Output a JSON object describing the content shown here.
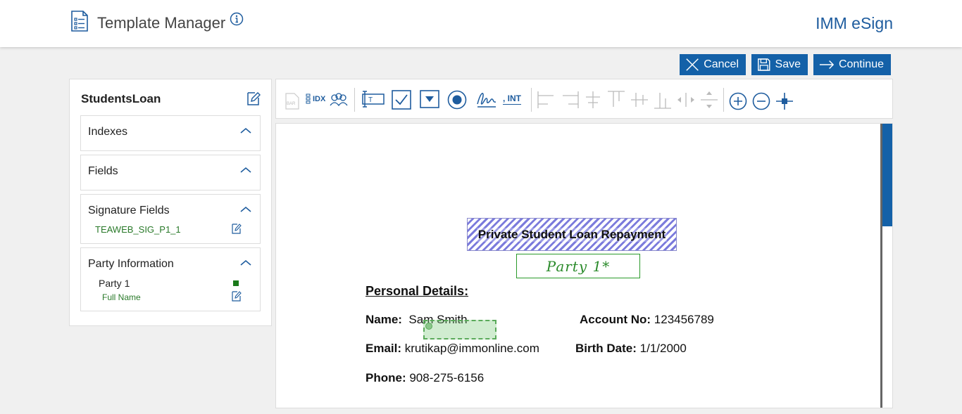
{
  "header": {
    "title": "Template Manager",
    "brand": "IMM eSign"
  },
  "actions": {
    "cancel": "Cancel",
    "save": "Save",
    "continue": "Continue"
  },
  "left_panel": {
    "template_name": "StudentsLoan",
    "sections": {
      "indexes": "Indexes",
      "fields": "Fields",
      "signature_fields": "Signature Fields",
      "party_information": "Party Information"
    },
    "signature_items": [
      "TEAWEB_SIG_P1_1"
    ],
    "party": {
      "name": "Party 1",
      "field": "Full Name",
      "color": "#1a7a1a"
    }
  },
  "toolbar": {
    "idx_label": "IDX",
    "int_label": ", INT"
  },
  "document": {
    "title": "Private Student Loan Repayment",
    "party_label": "Party 1*",
    "section_heading": "Personal Details:",
    "name_label": "Name:",
    "name_value": "Sam Smith",
    "account_label": "Account No:",
    "account_value": "123456789",
    "email_label": "Email:",
    "email_value": "krutikap@immonline.com",
    "birth_label": "Birth Date:",
    "birth_value": "1/1/2000",
    "phone_label": "Phone:",
    "phone_value": "908-275-6156"
  },
  "colors": {
    "primary": "#1461a8",
    "brand": "#1e5c9e",
    "party_green": "#2a8a2a"
  }
}
